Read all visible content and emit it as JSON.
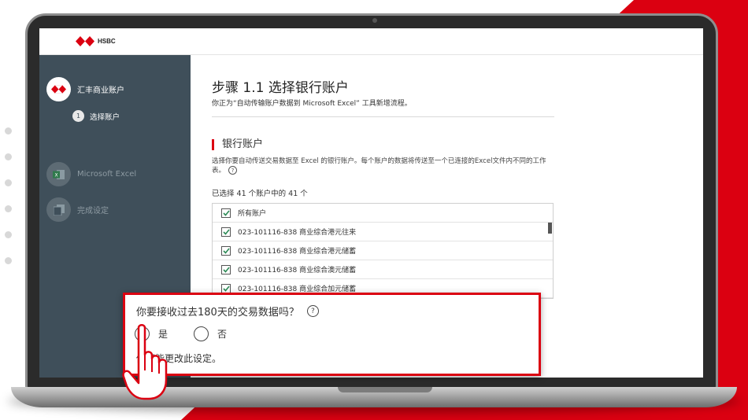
{
  "brand": {
    "logo_text": "HSBC",
    "red": "#db0011",
    "sidebar_bg": "#3f4f5a"
  },
  "sidebar": {
    "steps": [
      {
        "label": "汇丰商业账户",
        "icon": "hsbc-hexagon-icon",
        "state": "active"
      },
      {
        "label": "Microsoft Excel",
        "icon": "excel-icon",
        "state": "pending"
      },
      {
        "label": "完成设定",
        "icon": "document-icon",
        "state": "pending"
      }
    ],
    "sub_step": {
      "number": "1",
      "label": "选择账户"
    }
  },
  "main": {
    "title": "步骤 1.1 选择银行账户",
    "subtitle": "你正为“自动传输账户数据到 Microsoft Excel” 工具新增流程。",
    "section_title": "银行账户",
    "description": "选择你要自动传送交易数据至 Excel 的银行账户。每个账户的数据将传送至一个已连接的Excel文件内不同的工作表。",
    "selected_count": "已选择 41 个账户中的 41 个",
    "accounts": [
      {
        "label": "所有账户",
        "checked": true
      },
      {
        "label": "023-101116-838 商业综合港元往来",
        "checked": true
      },
      {
        "label": "023-101116-838 商业综合港元储蓄",
        "checked": true
      },
      {
        "label": "023-101116-838 商业综合澳元储蓄",
        "checked": true
      },
      {
        "label": "023-101116-838 商业综合加元储蓄",
        "checked": true
      }
    ]
  },
  "popup": {
    "question": "你要接收过去180天的交易数据吗？",
    "option_yes": "是",
    "option_no": "否",
    "note": "你不能更改此设定。"
  }
}
